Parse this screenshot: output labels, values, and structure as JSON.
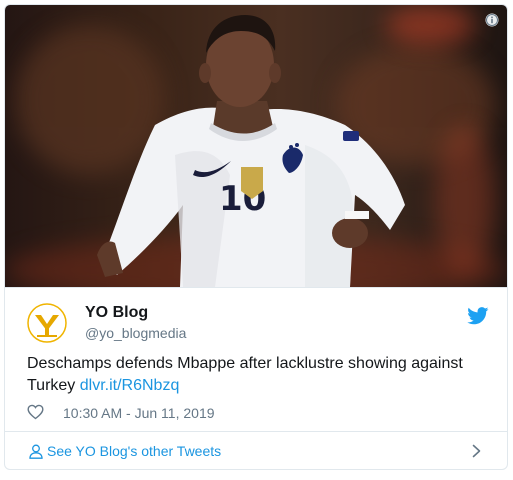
{
  "tweet": {
    "account_name": "YO Blog",
    "handle": "@yo_blogmedia",
    "text": "Deschamps defends Mbappe after lacklustre showing against Turkey ",
    "link_text": "dlvr.it/R6Nbzq",
    "timestamp": "10:30 AM - Jun 11, 2019"
  },
  "footer": {
    "other_tweets_label": "See YO Blog's other Tweets"
  },
  "media": {
    "shirt_number": "10"
  },
  "colors": {
    "link": "#1b95e0",
    "muted": "#657786",
    "border": "#e1e8ed"
  },
  "icons": [
    "info-icon",
    "avatar-logo",
    "twitter-bird-icon",
    "heart-icon",
    "person-icon",
    "chevron-right-icon"
  ]
}
